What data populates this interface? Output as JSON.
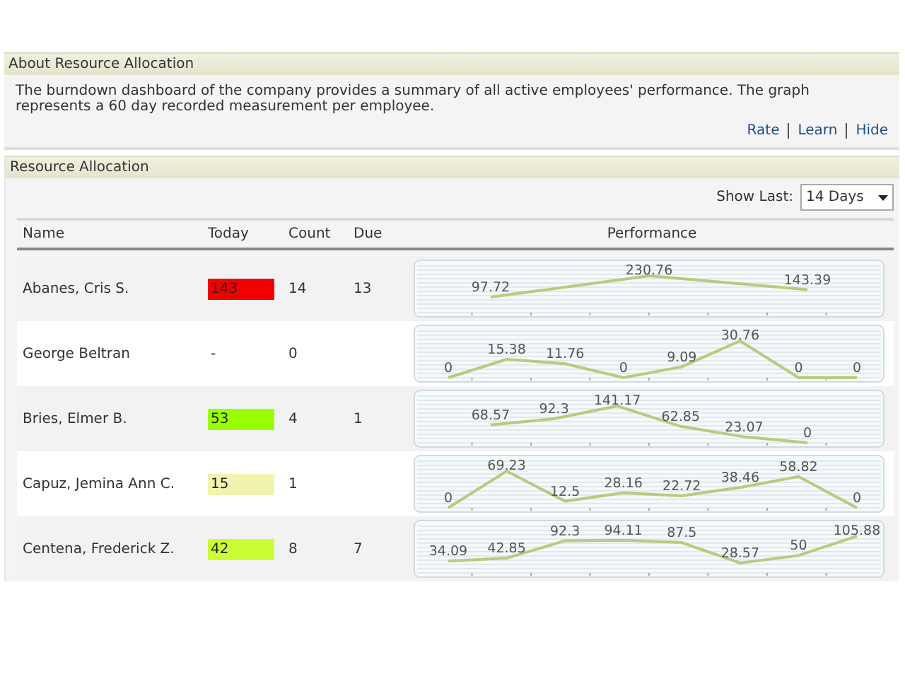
{
  "about": {
    "title": "About Resource Allocation",
    "text": "The burndown dashboard of the company provides a summary of all active employees' performance.  The graph represents a 60 day recorded measurement per employee.",
    "links": [
      "Rate",
      "Learn",
      "Hide"
    ]
  },
  "resource": {
    "title": "Resource Allocation",
    "show_last": {
      "label": "Show Last:",
      "value": "14 Days"
    },
    "columns": [
      "Name",
      "Today",
      "Count",
      "Due",
      "Performance"
    ],
    "rows": [
      {
        "name": "Abanes, Cris S.",
        "today": "143",
        "color": "#f00000",
        "count": "14",
        "due": "13",
        "chart_data": {
          "type": "line",
          "categories": [
            null,
            null,
            null
          ],
          "series": [
            {
              "color": "#b6cc7e",
              "values": [
                97.72,
                230.76,
                143.39
              ]
            }
          ],
          "data_labels": true
        }
      },
      {
        "name": "George Beltran",
        "today": "-",
        "count": "0",
        "chart_data": {
          "type": "line",
          "categories": [
            null,
            null,
            null,
            null,
            null,
            null,
            null,
            null
          ],
          "series": [
            {
              "color": "#b6cc7e",
              "values": [
                0,
                15.38,
                11.76,
                0,
                9.09,
                30.76,
                0,
                0
              ]
            }
          ],
          "data_labels": true
        }
      },
      {
        "name": "Bries, Elmer B.",
        "today": "53",
        "color": "#99ff00",
        "count": "4",
        "due": "1",
        "chart_data": {
          "type": "line",
          "categories": [
            null,
            null,
            null,
            null,
            null,
            null
          ],
          "series": [
            {
              "color": "#b6cc7e",
              "values": [
                68.57,
                92.3,
                141.17,
                62.85,
                23.07,
                0
              ]
            }
          ],
          "data_labels": true
        }
      },
      {
        "name": "Capuz, Jemina Ann C.",
        "today": "15",
        "color": "#f3f3b0",
        "count": "1",
        "chart_data": {
          "type": "line",
          "categories": [
            null,
            null,
            null,
            null,
            null,
            null,
            null,
            null
          ],
          "series": [
            {
              "color": "#b6cc7e",
              "values": [
                0,
                69.23,
                12.5,
                28.16,
                22.72,
                38.46,
                58.82,
                0
              ]
            }
          ],
          "data_labels": true
        }
      },
      {
        "name": "Centena, Frederick Z.",
        "today": "42",
        "color": "#ccff33",
        "count": "8",
        "due": "7",
        "chart_data": {
          "type": "line",
          "categories": [
            null,
            null,
            null,
            null,
            null,
            null,
            null,
            null
          ],
          "series": [
            {
              "color": "#b6cc7e",
              "values": [
                34.09,
                42.85,
                92.3,
                94.11,
                87.5,
                28.57,
                50,
                105.88
              ]
            }
          ],
          "data_labels": true
        }
      }
    ]
  }
}
